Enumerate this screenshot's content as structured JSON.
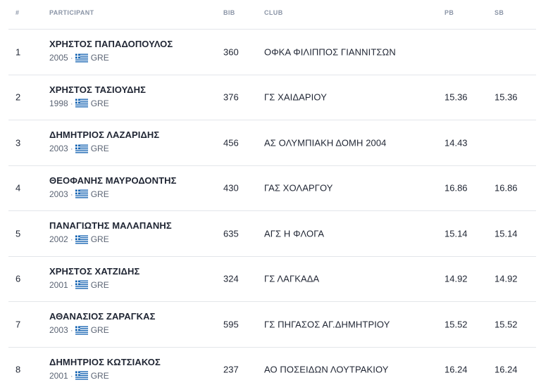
{
  "headers": {
    "rank": "#",
    "participant": "PARTICIPANT",
    "bib": "BIB",
    "club": "CLUB",
    "pb": "PB",
    "sb": "SB"
  },
  "rows": [
    {
      "rank": "1",
      "name": "ΧΡΗΣΤΟΣ ΠΑΠΑΔΟΠΟΥΛΟΣ",
      "year": "2005",
      "country": "GRE",
      "bib": "360",
      "club": "ΟΦΚΑ ΦΙΛΙΠΠΟΣ ΓΙΑΝΝΙΤΣΩΝ",
      "pb": "",
      "sb": ""
    },
    {
      "rank": "2",
      "name": "ΧΡΗΣΤΟΣ ΤΑΣΙΟΥΔΗΣ",
      "year": "1998",
      "country": "GRE",
      "bib": "376",
      "club": "ΓΣ ΧΑΙΔΑΡΙΟΥ",
      "pb": "15.36",
      "sb": "15.36"
    },
    {
      "rank": "3",
      "name": "ΔΗΜΗΤΡΙΟΣ ΛΑΖΑΡΙΔΗΣ",
      "year": "2003",
      "country": "GRE",
      "bib": "456",
      "club": "ΑΣ ΟΛΥΜΠΙΑΚΗ ΔΟΜΗ 2004",
      "pb": "14.43",
      "sb": ""
    },
    {
      "rank": "4",
      "name": "ΘΕΟΦΑΝΗΣ ΜΑΥΡΟΔΟΝΤΗΣ",
      "year": "2003",
      "country": "GRE",
      "bib": "430",
      "club": "ΓΑΣ ΧΟΛΑΡΓΟΥ",
      "pb": "16.86",
      "sb": "16.86"
    },
    {
      "rank": "5",
      "name": "ΠΑΝΑΓΙΩΤΗΣ ΜΑΛΑΠΑΝΗΣ",
      "year": "2002",
      "country": "GRE",
      "bib": "635",
      "club": "ΑΓΣ Η ΦΛΟΓΑ",
      "pb": "15.14",
      "sb": "15.14"
    },
    {
      "rank": "6",
      "name": "ΧΡΗΣΤΟΣ ΧΑΤΖΙΔΗΣ",
      "year": "2001",
      "country": "GRE",
      "bib": "324",
      "club": "ΓΣ ΛΑΓΚΑΔΑ",
      "pb": "14.92",
      "sb": "14.92"
    },
    {
      "rank": "7",
      "name": "ΑΘΑΝΑΣΙΟΣ ΖΑΡΑΓΚΑΣ",
      "year": "2003",
      "country": "GRE",
      "bib": "595",
      "club": "ΓΣ ΠΗΓΑΣΟΣ ΑΓ.ΔΗΜΗΤΡΙΟΥ",
      "pb": "15.52",
      "sb": "15.52"
    },
    {
      "rank": "8",
      "name": "ΔΗΜΗΤΡΙΟΣ ΚΩΤΣΙΑΚΟΣ",
      "year": "2001",
      "country": "GRE",
      "bib": "237",
      "club": "ΑΟ ΠΟΣΕΙΔΩΝ ΛΟΥΤΡΑΚΙΟΥ",
      "pb": "16.24",
      "sb": "16.24"
    }
  ],
  "meta_separator": "·",
  "icons": {
    "flag": "greece-flag-icon"
  },
  "colors": {
    "flag_blue": "#0d5eaf",
    "flag_white": "#ffffff"
  }
}
